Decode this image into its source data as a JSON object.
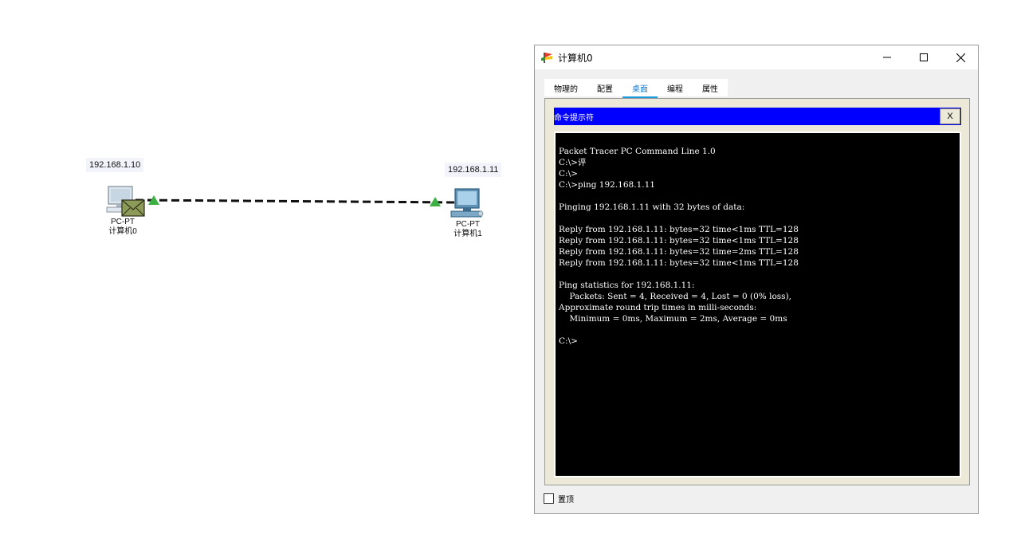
{
  "topology": {
    "pc0": {
      "ip": "192.168.1.10",
      "type": "PC-PT",
      "name": "计算机0"
    },
    "pc1": {
      "ip": "192.168.1.11",
      "type": "PC-PT",
      "name": "计算机1"
    },
    "link_color": "#111111",
    "port_up_color": "#3cb043"
  },
  "window": {
    "title": "计算机0",
    "controls": {
      "minimize": "minimize-icon",
      "maximize": "maximize-icon",
      "close": "close-icon"
    },
    "tabs": [
      {
        "label": "物理的"
      },
      {
        "label": "配置"
      },
      {
        "label": "桌面",
        "active": true
      },
      {
        "label": "编程"
      },
      {
        "label": "属性"
      }
    ],
    "command_prompt": {
      "title": "命令提示符",
      "close_label": "X",
      "header_color": "#0000ff",
      "lines": [
        "Packet Tracer PC Command Line 1.0",
        "C:\\>评",
        "C:\\>",
        "C:\\>ping 192.168.1.11",
        "",
        "Pinging 192.168.1.11 with 32 bytes of data:",
        "",
        "Reply from 192.168.1.11: bytes=32 time<1ms TTL=128",
        "Reply from 192.168.1.11: bytes=32 time<1ms TTL=128",
        "Reply from 192.168.1.11: bytes=32 time=2ms TTL=128",
        "Reply from 192.168.1.11: bytes=32 time<1ms TTL=128",
        "",
        "Ping statistics for 192.168.1.11:",
        "    Packets: Sent = 4, Received = 4, Lost = 0 (0% loss),",
        "Approximate round trip times in milli-seconds:",
        "    Minimum = 0ms, Maximum = 2ms, Average = 0ms",
        "",
        "C:\\>"
      ]
    },
    "pin_on_top": {
      "label": "置顶",
      "checked": false
    }
  }
}
